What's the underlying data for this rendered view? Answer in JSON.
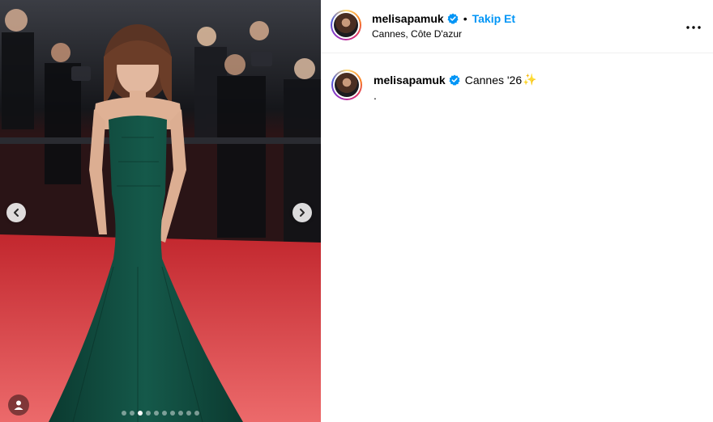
{
  "post": {
    "username": "melisapamuk",
    "separator": "•",
    "follow_label": "Takip Et",
    "location": "Cannes, Côte D'azur",
    "more_icon": "more-horizontal-icon"
  },
  "caption": {
    "username": "melisapamuk",
    "text": "Cannes '26",
    "emoji": "✨",
    "second_line": "."
  },
  "carousel": {
    "slide_count": 10,
    "active_index": 2,
    "prev_icon": "chevron-left-icon",
    "next_icon": "chevron-right-icon",
    "tag_icon": "user-tag-icon"
  },
  "colors": {
    "accent": "#0095f6",
    "verified": "#0095f6",
    "gown": "#0f4a3c",
    "carpet": "#dc3a3f"
  }
}
